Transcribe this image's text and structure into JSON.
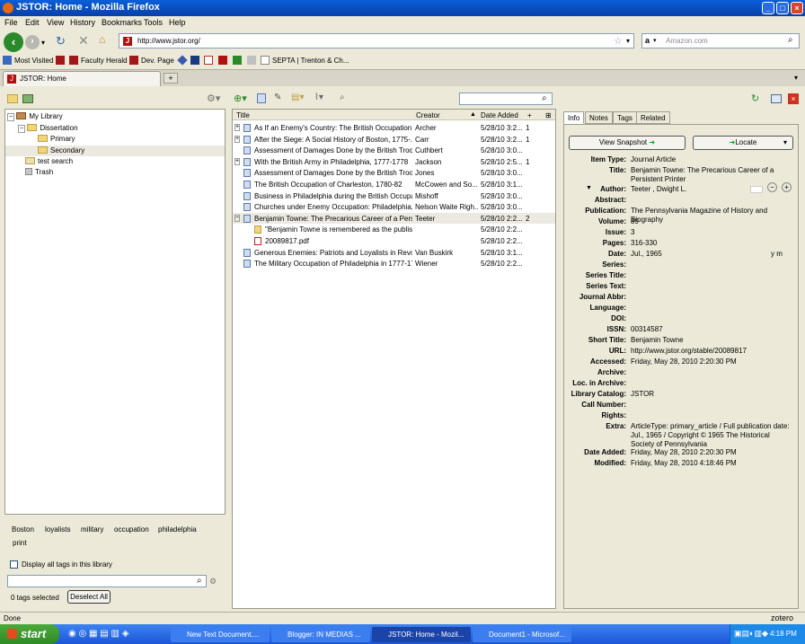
{
  "window": {
    "title": "JSTOR: Home - Mozilla Firefox"
  },
  "menu": [
    "File",
    "Edit",
    "View",
    "History",
    "Bookmarks",
    "Tools",
    "Help"
  ],
  "nav": {
    "url": "http://www.jstor.org/",
    "search_placeholder": "Amazon.com"
  },
  "bookmarks": [
    "Most Visited",
    "Faculty Herald",
    "Dev. Page",
    "SEPTA | Trenton & Ch..."
  ],
  "tab": {
    "label": "JSTOR: Home"
  },
  "library": {
    "items": [
      "My Library",
      "Dissertation",
      "Primary",
      "Secondary",
      "test search",
      "Trash"
    ]
  },
  "tags": {
    "list": [
      "Boston",
      "loyalists",
      "military",
      "occupation",
      "philadelphia",
      "print"
    ],
    "display_all_label": "Display all tags in this library",
    "selected_count": "0 tags selected",
    "deselect_label": "Deselect All"
  },
  "items": {
    "columns": {
      "title": "Title",
      "creator": "Creator",
      "date": "Date Added",
      "plus": "+"
    },
    "rows": [
      {
        "title": "As If an Enemy's Country: The British Occupation ...",
        "creator": "Archer",
        "date": "5/28/10 3:2...",
        "count": "1"
      },
      {
        "title": "After the Siege: A Social History of Boston, 1775-...",
        "creator": "Carr",
        "date": "5/28/10 3:2...",
        "count": "1"
      },
      {
        "title": "Assessment of Damages Done by the British Troop...",
        "creator": "Cuthbert",
        "date": "5/28/10 3:0...",
        "count": ""
      },
      {
        "title": "With the British Army in Philadelphia, 1777-1778",
        "creator": "Jackson",
        "date": "5/28/10 2:5...",
        "count": "1"
      },
      {
        "title": "Assessment of Damages Done by the British Troop...",
        "creator": "Jones",
        "date": "5/28/10 3:0...",
        "count": ""
      },
      {
        "title": "The British Occupation of Charleston, 1780-82",
        "creator": "McCowen and So...",
        "date": "5/28/10 3:1...",
        "count": ""
      },
      {
        "title": "Business in Philadelphia during the British Occupati...",
        "creator": "Mishoff",
        "date": "5/28/10 3:0...",
        "count": ""
      },
      {
        "title": "Churches under Enemy Occupation: Philadelphia, ...",
        "creator": "Nelson Waite Righ...",
        "date": "5/28/10 3:0...",
        "count": ""
      },
      {
        "title": "Benjamin Towne: The Precarious Career of a Persi...",
        "creator": "Teeter",
        "date": "5/28/10 2:2...",
        "count": "2"
      },
      {
        "title": "\"Benjamin Towne is remembered as the publish...",
        "creator": "",
        "date": "5/28/10 2:2...",
        "count": ""
      },
      {
        "title": "20089817.pdf",
        "creator": "",
        "date": "5/28/10 2:2...",
        "count": ""
      },
      {
        "title": "Generous Enemies: Patriots and Loyalists in Revol...",
        "creator": "Van Buskirk",
        "date": "5/28/10 3:1...",
        "count": ""
      },
      {
        "title": "The Military Occupation of Philadelphia in 1777-1778",
        "creator": "Wiener",
        "date": "5/28/10 2:2...",
        "count": ""
      }
    ]
  },
  "info": {
    "tabs": [
      "Info",
      "Notes",
      "Tags",
      "Related"
    ],
    "view_snapshot": "View Snapshot",
    "locate": "Locate",
    "fields": [
      {
        "label": "Item Type:",
        "value": "Journal Article"
      },
      {
        "label": "Title:",
        "value": "Benjamin Towne: The Precarious Career of a Persistent Printer"
      },
      {
        "label": "Author:",
        "value": "Teeter   ,   Dwight L."
      },
      {
        "label": "Abstract:",
        "value": ""
      },
      {
        "label": "Publication:",
        "value": "The Pennsylvania Magazine of History and Biography"
      },
      {
        "label": "Volume:",
        "value": "89"
      },
      {
        "label": "Issue:",
        "value": "3"
      },
      {
        "label": "Pages:",
        "value": "316-330"
      },
      {
        "label": "Date:",
        "value": "Jul., 1965"
      },
      {
        "label": "Series:",
        "value": ""
      },
      {
        "label": "Series Title:",
        "value": ""
      },
      {
        "label": "Series Text:",
        "value": ""
      },
      {
        "label": "Journal Abbr:",
        "value": ""
      },
      {
        "label": "Language:",
        "value": ""
      },
      {
        "label": "DOI:",
        "value": ""
      },
      {
        "label": "ISSN:",
        "value": "00314587"
      },
      {
        "label": "Short Title:",
        "value": "Benjamin Towne"
      },
      {
        "label": "URL:",
        "value": "http://www.jstor.org/stable/20089817"
      },
      {
        "label": "Accessed:",
        "value": "Friday, May 28, 2010 2:20:30 PM"
      },
      {
        "label": "Archive:",
        "value": ""
      },
      {
        "label": "Loc. in Archive:",
        "value": ""
      },
      {
        "label": "Library Catalog:",
        "value": "JSTOR"
      },
      {
        "label": "Call Number:",
        "value": ""
      },
      {
        "label": "Rights:",
        "value": ""
      },
      {
        "label": "Extra:",
        "value": "ArticleType: primary_article / Full publication date: Jul., 1965 / Copyright © 1965 The Historical Society of Pennsylvania"
      },
      {
        "label": "Date Added:",
        "value": "Friday, May 28, 2010 2:20:30 PM"
      },
      {
        "label": "Modified:",
        "value": "Friday, May 28, 2010 4:18:46 PM"
      }
    ],
    "date_ymd": "y   m"
  },
  "status": {
    "left": "Done",
    "right": "zotero"
  },
  "taskbar": {
    "start": "start",
    "tasks": [
      "New Text Document....",
      "Blogger: IN MEDIAS ...",
      "JSTOR: Home - Mozil...",
      "Document1 - Microsof..."
    ],
    "clock": "4:18 PM"
  },
  "colors": {
    "titlebar": "#0a5fd8",
    "taskbar": "#1c56d8",
    "start": "#2e8a24"
  }
}
